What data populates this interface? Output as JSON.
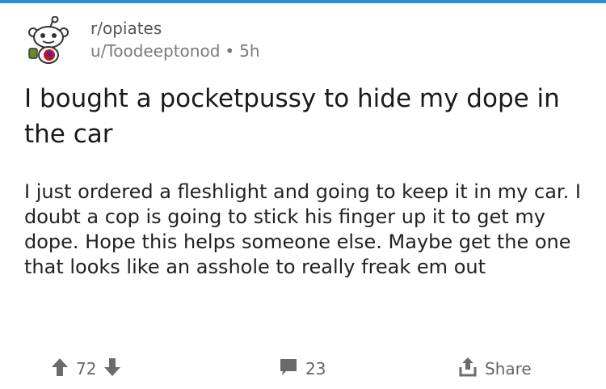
{
  "post": {
    "subreddit": "r/opiates",
    "author": "u/Toodeeptonod",
    "separator": "•",
    "age": "5h",
    "title": "I bought a pocketpussy to hide my dope in the car",
    "body": "I just ordered a fleshlight and going to keep it in my car. I doubt a cop is going to stick his finger up it to get my dope. Hope this helps someone else. Maybe get the one that looks like an asshole to really freak em out"
  },
  "actions": {
    "score": "72",
    "comments": "23",
    "share_label": "Share"
  },
  "icons": {
    "upvote": "upvote-arrow-icon",
    "downvote": "downvote-arrow-icon",
    "comment": "comment-bubble-icon",
    "share": "share-icon",
    "avatar": "snoo-avatar-icon"
  },
  "colors": {
    "accent_bar": "#2a8fd6",
    "icon_gray": "#6b6b6b",
    "avatar_red": "#c8102e"
  }
}
